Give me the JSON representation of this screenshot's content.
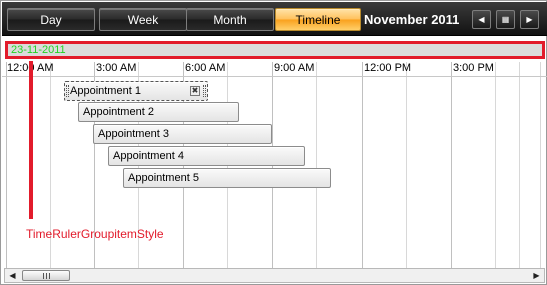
{
  "toolbar": {
    "views": [
      {
        "label": "Day",
        "active": false
      },
      {
        "label": "Week",
        "active": false
      },
      {
        "label": "Month",
        "active": false
      },
      {
        "label": "Timeline",
        "active": true
      }
    ],
    "period_label": "November 2011",
    "nav": {
      "prev_icon": "chevron-left-icon",
      "calendar_icon": "calendar-grid-icon",
      "next_icon": "chevron-right-icon"
    }
  },
  "group": {
    "label": "23-11-2011",
    "text_color": "#24d324",
    "highlight_color": "#e21b2b"
  },
  "ruler": {
    "labels": [
      "12:00 AM",
      "3:00 AM",
      "6:00 AM",
      "9:00 AM",
      "12:00 PM",
      "3:00 PM"
    ]
  },
  "appointments": [
    {
      "subject": "Appointment 1"
    },
    {
      "subject": "Appointment 2"
    },
    {
      "subject": "Appointment 3"
    },
    {
      "subject": "Appointment 4"
    },
    {
      "subject": "Appointment 5"
    }
  ],
  "annotation": {
    "label": "TimeRulerGroupitemStyle"
  },
  "scrollbar": {
    "left_icon": "arrow-left-icon",
    "right_icon": "arrow-right-icon"
  }
}
